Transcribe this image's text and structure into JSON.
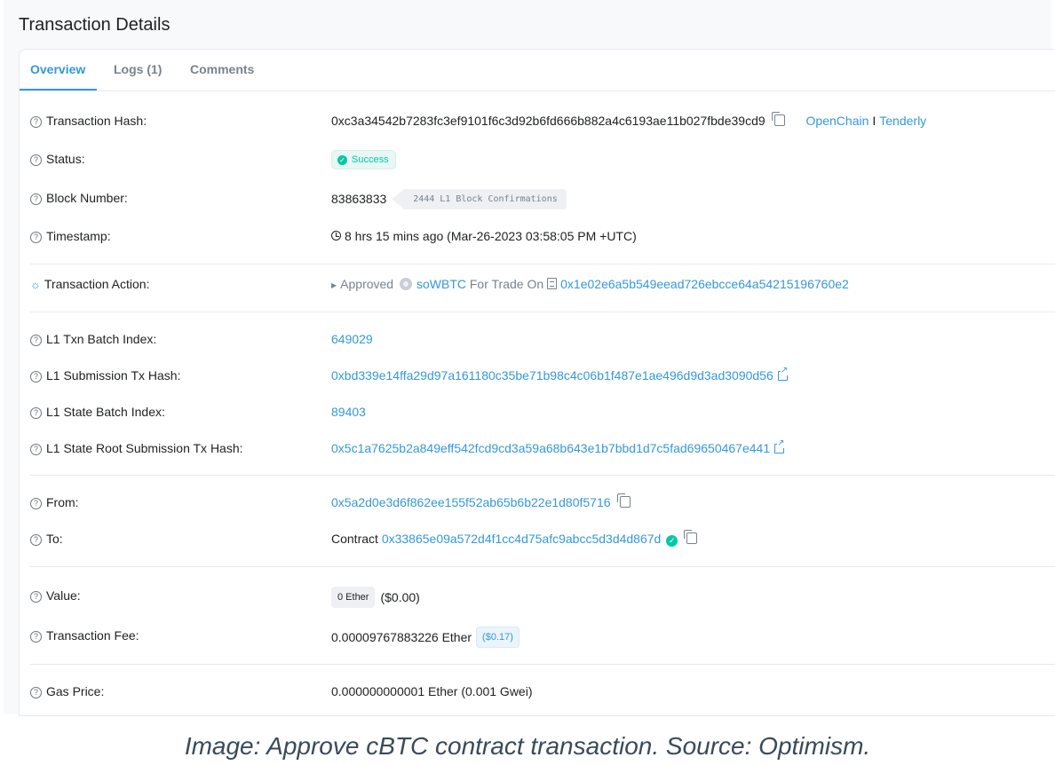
{
  "page": {
    "title": "Transaction Details"
  },
  "tabs": [
    {
      "label": "Overview",
      "active": true
    },
    {
      "label": "Logs (1)",
      "active": false
    },
    {
      "label": "Comments",
      "active": false
    }
  ],
  "rows": {
    "tx_hash": {
      "label": "Transaction Hash:",
      "value": "0xc3a34542b7283fc3ef9101f6c3d92b6fd666b882a4c6193ae11b027fbde39cd9",
      "link_openchain": "OpenChain",
      "separator": "I",
      "link_tenderly": "Tenderly"
    },
    "status": {
      "label": "Status:",
      "value": "Success"
    },
    "block": {
      "label": "Block Number:",
      "value": "83863833",
      "confirmations": "2444 L1 Block Confirmations"
    },
    "timestamp": {
      "label": "Timestamp:",
      "value": "8 hrs 15 mins ago (Mar-26-2023 03:58:05 PM +UTC)"
    },
    "action": {
      "label": "Transaction Action:",
      "verb": "Approved",
      "token": "soWBTC",
      "middle": "For Trade On",
      "address": "0x1e02e6a5b549eead726ebcce64a54215196760e2"
    },
    "l1_batch_index": {
      "label": "L1 Txn Batch Index:",
      "value": "649029"
    },
    "l1_submission": {
      "label": "L1 Submission Tx Hash:",
      "value": "0xbd339e14ffa29d97a161180c35be71b98c4c06b1f487e1ae496d9d3ad3090d56"
    },
    "l1_state_index": {
      "label": "L1 State Batch Index:",
      "value": "89403"
    },
    "l1_state_root": {
      "label": "L1 State Root Submission Tx Hash:",
      "value": "0x5c1a7625b2a849eff542fcd9cd3a59a68b643e1b7bbd1d7c5fad69650467e441"
    },
    "from": {
      "label": "From:",
      "value": "0x5a2d0e3d6f862ee155f52ab65b6b22e1d80f5716"
    },
    "to": {
      "label": "To:",
      "prefix": "Contract",
      "value": "0x33865e09a572d4f1cc4d75afc9abcc5d3d4d867d"
    },
    "value": {
      "label": "Value:",
      "badge": "0 Ether",
      "usd": "($0.00)"
    },
    "fee": {
      "label": "Transaction Fee:",
      "value": "0.00009767883226 Ether",
      "usd": "($0.17)"
    },
    "gas_price": {
      "label": "Gas Price:",
      "value": "0.000000000001 Ether (0.001 Gwei)"
    }
  },
  "caption": "Image: Approve cBTC contract transaction. Source: Optimism.",
  "colors": {
    "link": "#3498db",
    "success": "#00c9a7",
    "text": "#1e2022",
    "muted": "#77838f"
  },
  "icons": [
    "question-icon",
    "copy-icon",
    "external-link-icon",
    "clock-icon",
    "lightbulb-icon",
    "token-icon",
    "document-icon",
    "verified-icon",
    "check-circle-icon"
  ]
}
